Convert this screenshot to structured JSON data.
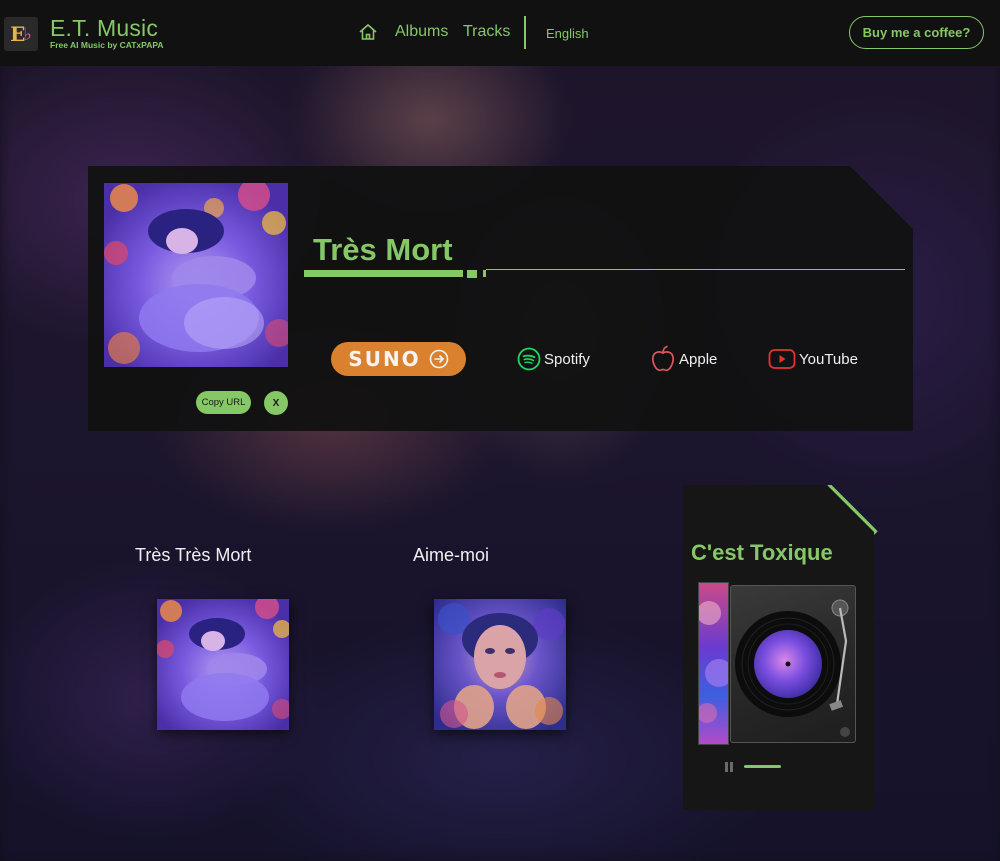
{
  "header": {
    "brand_name": "E.T. Music",
    "brand_tagline": "Free AI Music by CATxPAPA",
    "nav": {
      "albums": "Albums",
      "tracks": "Tracks",
      "language": "English"
    },
    "coffee_button": "Buy me a coffee?"
  },
  "track": {
    "title": "Très Mort",
    "copy_url_label": "Copy URL",
    "x_label": "X",
    "suno_label": "SUNO",
    "streams": {
      "spotify": "Spotify",
      "apple": "Apple",
      "youtube": "YouTube"
    }
  },
  "related": [
    {
      "title": "Très Très Mort"
    },
    {
      "title": "Aime-moi"
    }
  ],
  "player": {
    "title": "C'est Toxique",
    "progress_fraction": 0.2
  },
  "colors": {
    "accent": "#86c766",
    "suno": "#d9812e",
    "spotify": "#1ed760",
    "apple": "#e0545a",
    "youtube": "#e3342f"
  },
  "icons": {
    "home": "home-icon",
    "suno_arrow": "arrow-right-circle-icon",
    "spotify": "spotify-icon",
    "apple": "apple-icon",
    "youtube": "youtube-icon",
    "pause": "pause-icon"
  }
}
